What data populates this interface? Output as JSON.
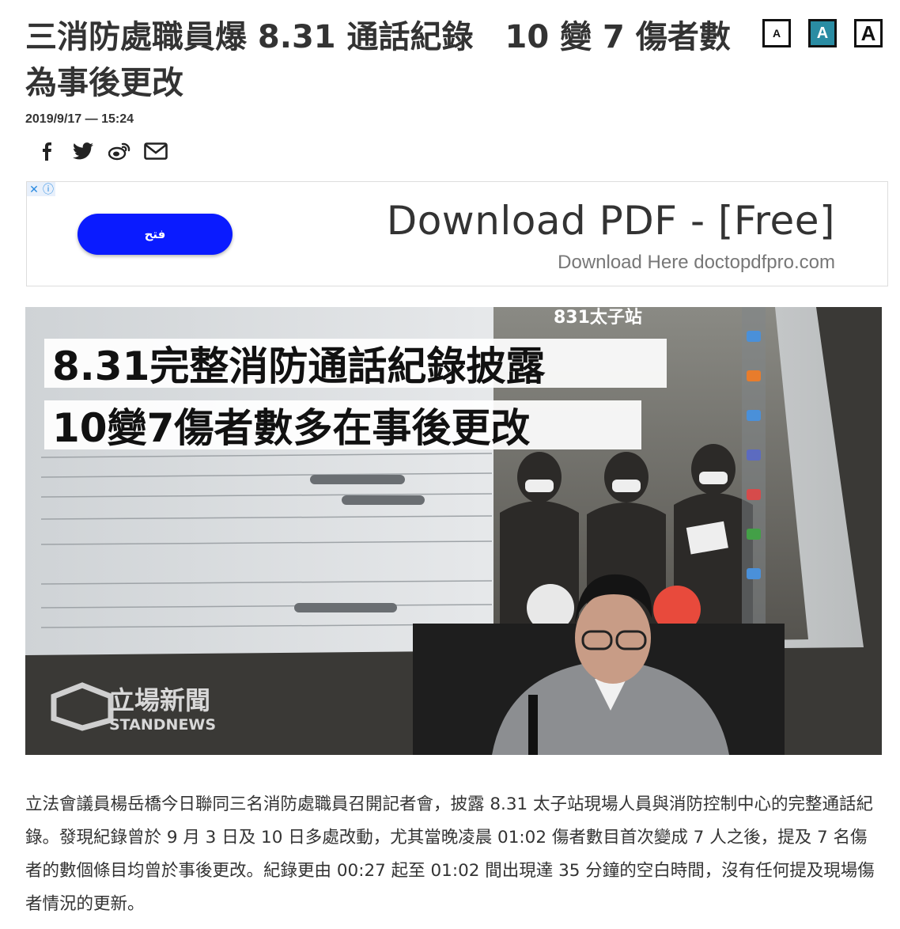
{
  "article": {
    "title": "三消防處職員爆 8.31 通話紀錄　10 變 7 傷者數為事後更改",
    "date": "2019/9/17 — 15:24",
    "body": "立法會議員楊岳橋今日聯同三名消防處職員召開記者會，披露 8.31 太子站現場人員與消防控制中心的完整通話紀錄。發現紀錄曾於 9 月 3 日及 10 日多處改動，尤其當晚凌晨 01:02 傷者數目首次變成 7 人之後，提及 7 名傷者的數個條目均曾於事後更改。紀錄更由  00:27 起至 01:02 間出現達 35 分鐘的空白時間，沒有任何提及現場傷者情況的更新。"
  },
  "font_size_controls": {
    "small": "A",
    "medium": "A",
    "large": "A"
  },
  "share_icons": [
    "facebook-icon",
    "twitter-icon",
    "weibo-icon",
    "email-icon"
  ],
  "ad": {
    "close_glyph": "✕",
    "info_glyph": "ⓘ",
    "button_label": "فتح",
    "title": "Download PDF - [Free]",
    "subtitle": "Download Here doctopdfpro.com"
  },
  "photo": {
    "headline_line1": "8.31完整消防通話紀錄披露",
    "headline_line2": "10變7傷者數多在事後更改",
    "screen_caption": "831太子站",
    "watermark_cn": "立場新聞",
    "watermark_en": "STANDNEWS"
  },
  "colors": {
    "accent": "#2a8ca3",
    "ad_button": "#0a1bff",
    "text": "#333333"
  }
}
